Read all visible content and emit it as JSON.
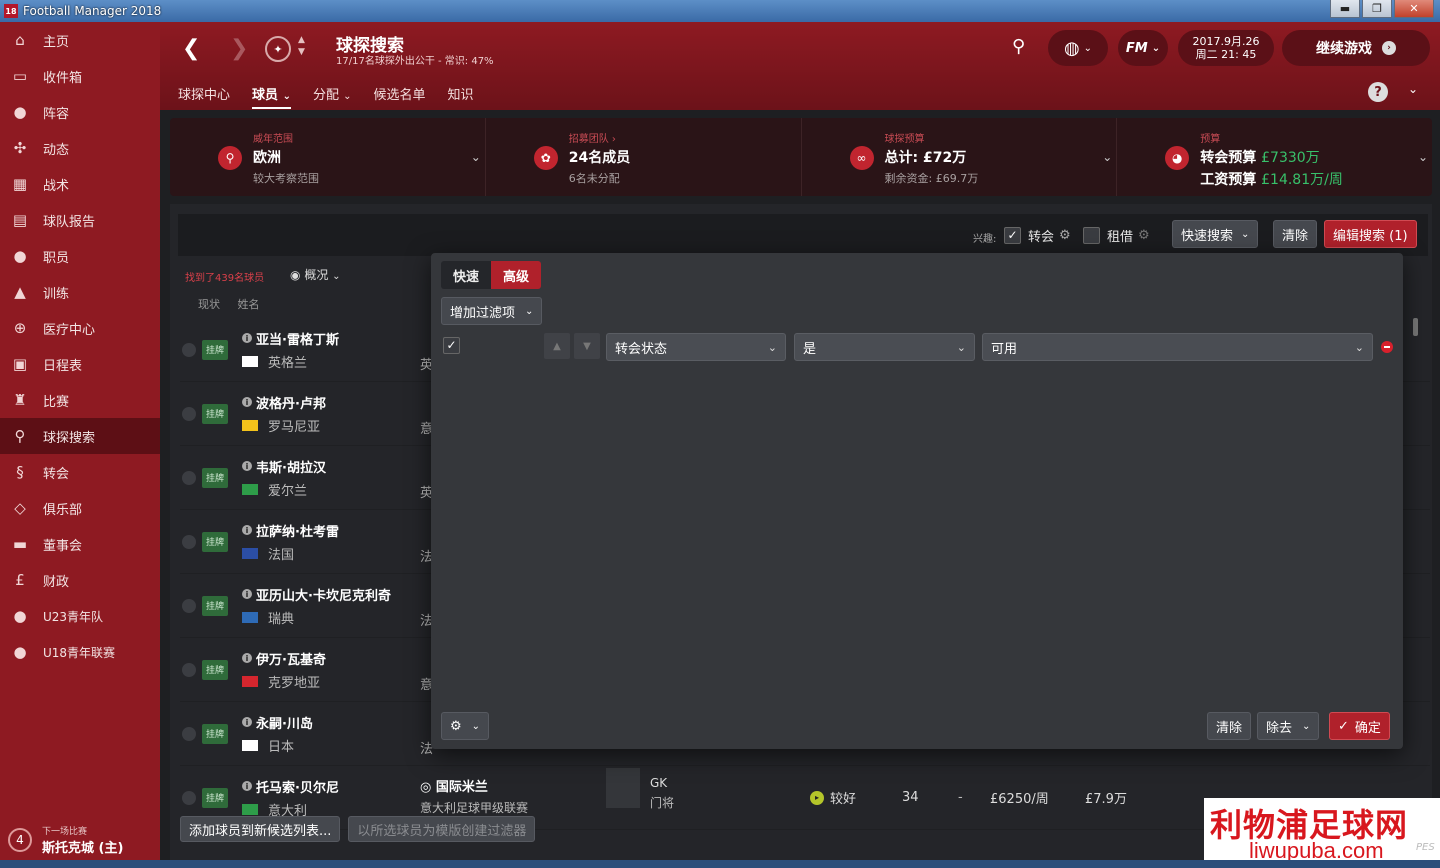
{
  "window": {
    "title": "Football Manager 2018",
    "badge": "18",
    "minimize": "▬",
    "maximize": "❐",
    "close": "✕"
  },
  "sidebar": {
    "items": [
      {
        "label": "主页",
        "icon": "home-icon"
      },
      {
        "label": "收件箱",
        "icon": "inbox-icon"
      },
      {
        "label": "阵容",
        "icon": "squad-icon"
      },
      {
        "label": "动态",
        "icon": "dynamics-icon"
      },
      {
        "label": "战术",
        "icon": "tactics-icon"
      },
      {
        "label": "球队报告",
        "icon": "report-icon"
      },
      {
        "label": "职员",
        "icon": "staff-icon"
      },
      {
        "label": "训练",
        "icon": "training-icon"
      },
      {
        "label": "医疗中心",
        "icon": "medical-icon"
      },
      {
        "label": "日程表",
        "icon": "calendar-icon"
      },
      {
        "label": "比赛",
        "icon": "trophy-icon"
      },
      {
        "label": "球探搜索",
        "icon": "search-icon"
      },
      {
        "label": "转会",
        "icon": "transfer-icon"
      },
      {
        "label": "俱乐部",
        "icon": "club-icon"
      },
      {
        "label": "董事会",
        "icon": "board-icon"
      },
      {
        "label": "财政",
        "icon": "finance-icon"
      },
      {
        "label": "U23青年队",
        "icon": "u23-icon"
      },
      {
        "label": "U18青年联赛",
        "icon": "u18-icon"
      }
    ],
    "next_match": {
      "number": "4",
      "label": "下一场比赛",
      "value": "斯托克城 (主)"
    }
  },
  "header": {
    "title": "球探搜索",
    "subtitle": "17/17名球探外出公干 - 常识: 47%",
    "date_line1": "2017.9月.26",
    "date_line2": "周二 21: 45",
    "continue_label": "继续游戏",
    "fm_label": "FM",
    "help_label": "?",
    "tabs": [
      {
        "label": "球探中心"
      },
      {
        "label": "球员"
      },
      {
        "label": "分配"
      },
      {
        "label": "候选名单"
      },
      {
        "label": "知识"
      }
    ]
  },
  "info_panels": [
    {
      "caption": "威年范围",
      "main": "欧洲",
      "sub": "较大考察范围"
    },
    {
      "caption": "招募团队 ›",
      "main": "24名成员",
      "sub": "6名未分配"
    },
    {
      "caption": "球探预算",
      "main": "总计: £72万",
      "sub": "剩余资金: £69.7万"
    },
    {
      "caption": "预算",
      "main_label": "转会预算",
      "main_value": "£7330万",
      "sub_label": "工资预算",
      "sub_value": "£14.81万/周"
    }
  ],
  "toolbar": {
    "interest_label": "兴趣:",
    "transfer_label": "转会",
    "loan_label": "租借",
    "quick_search": "快速搜索",
    "clear": "清除",
    "edit_search": "编辑搜索 (1)"
  },
  "list": {
    "found": "找到了439名球员",
    "view_label": "概况",
    "col_status": "现状",
    "col_name": "姓名",
    "col_club": "俱",
    "players": [
      {
        "tag": "挂牌",
        "name": "亚当·雷格丁斯",
        "nation": "英格兰",
        "club": "英",
        "flag": "#ffffff"
      },
      {
        "tag": "挂牌",
        "name": "波格丹·卢邦",
        "nation": "罗马尼亚",
        "club": "意",
        "flag": "#f3c31b"
      },
      {
        "tag": "挂牌",
        "name": "韦斯·胡拉汉",
        "nation": "爱尔兰",
        "club": "英",
        "flag": "#2e9d49"
      },
      {
        "tag": "挂牌",
        "name": "拉萨纳·杜考雷",
        "nation": "法国",
        "club": "法",
        "flag": "#2b4ea5"
      },
      {
        "tag": "挂牌",
        "name": "亚历山大·卡坎尼克利奇",
        "nation": "瑞典",
        "club": "法",
        "flag": "#2e6bb6"
      },
      {
        "tag": "挂牌",
        "name": "伊万·瓦基奇",
        "nation": "克罗地亚",
        "club": "意",
        "flag": "#d5262e"
      },
      {
        "tag": "挂牌",
        "name": "永嗣·川岛",
        "nation": "日本",
        "club": "法",
        "flag": "#ffffff"
      },
      {
        "tag": "挂牌",
        "name": "托马索·贝尔尼",
        "nation": "意大利",
        "club": "国际米兰",
        "club_sub": "意大利足球甲级联赛",
        "flag": "#2e9d49",
        "pos": "GK",
        "pos_sub": "门将",
        "rating": "较好",
        "age": "34",
        "dash": "-",
        "wage": "£6250/周",
        "value": "£7.9万"
      }
    ],
    "add_to_shortlist": "添加球员到新候选列表...",
    "create_filter": "以所选球员为模版创建过滤器"
  },
  "modal": {
    "tab_quick": "快速",
    "tab_advanced": "高级",
    "add_filter": "增加过滤项",
    "filter": {
      "field": "转会状态",
      "operator": "是",
      "value": "可用"
    },
    "clear": "清除",
    "remove": "除去",
    "confirm": "确定"
  },
  "watermark": {
    "cn": "利物浦足球网",
    "url": "liwupuba.com",
    "pes": "PES"
  },
  "colors": {
    "accent": "#b0212b",
    "sidebar": "#8e1a22",
    "header_dark": "#6c1219"
  }
}
